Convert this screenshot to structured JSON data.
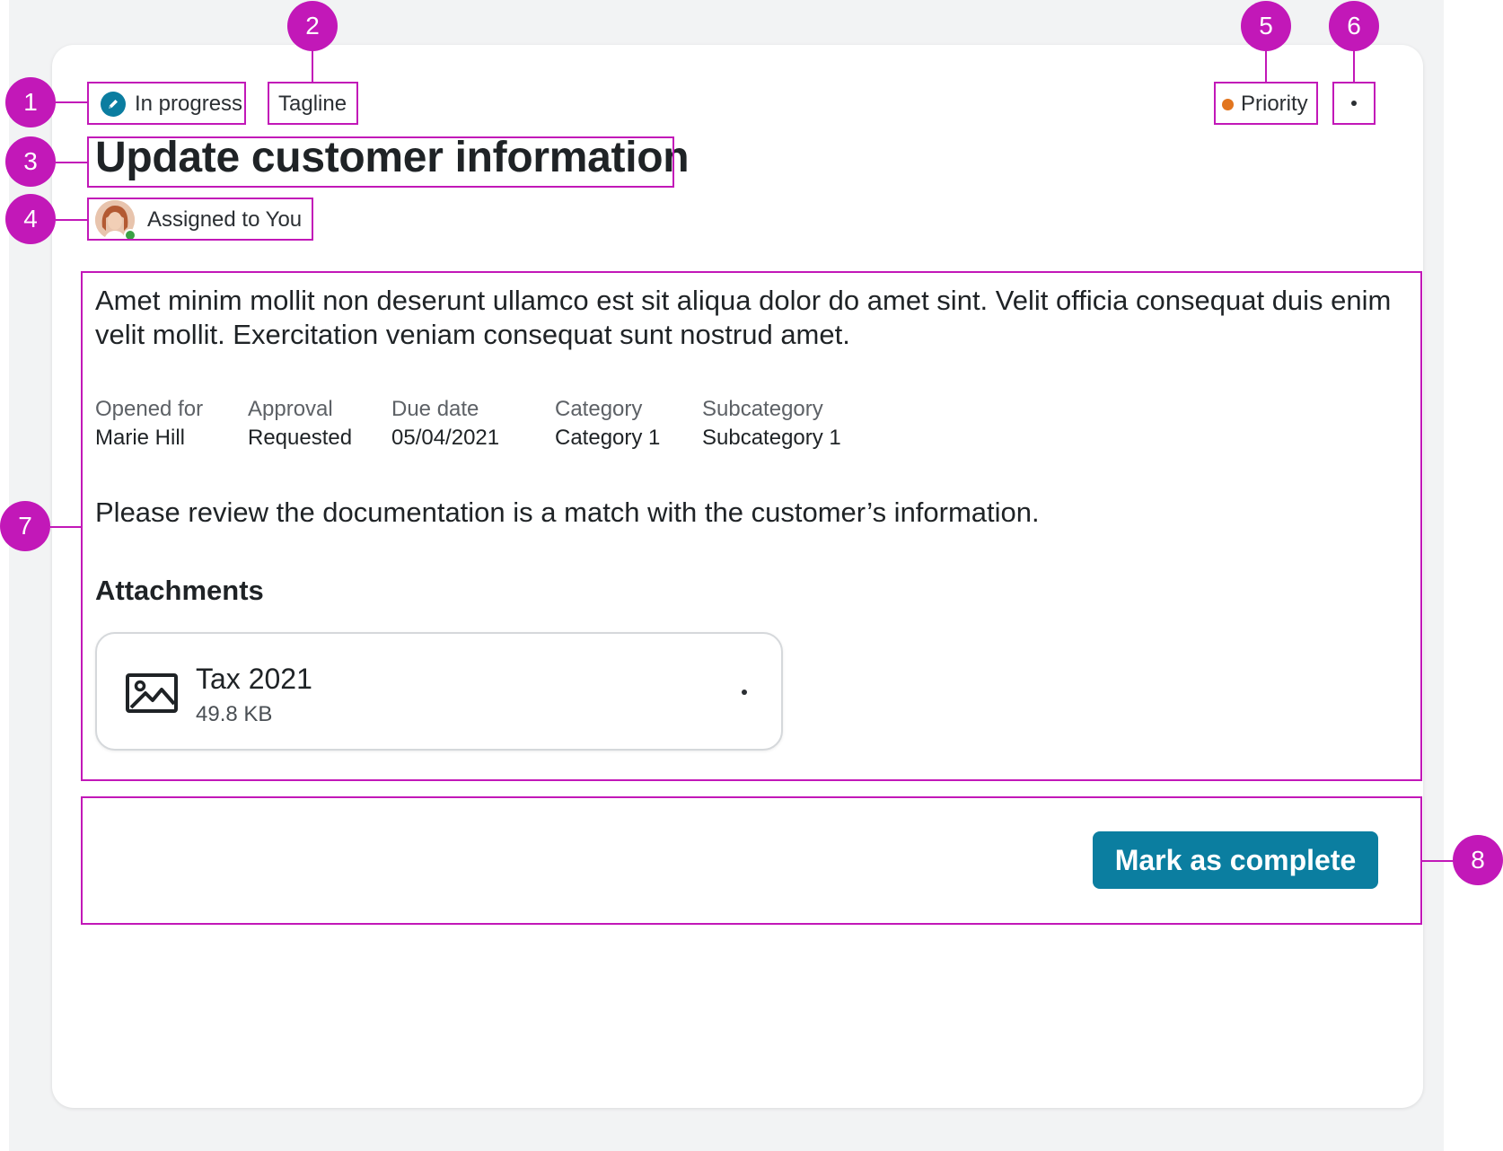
{
  "markers": [
    "1",
    "2",
    "3",
    "4",
    "5",
    "6",
    "7",
    "8"
  ],
  "header": {
    "status_label": "In progress",
    "status_icon": "pencil-icon",
    "tagline": "Tagline",
    "priority_label": "Priority",
    "priority_color": "#e2751e",
    "more_icon": "kebab-menu-icon"
  },
  "task": {
    "title": "Update customer information",
    "assignee_label": "Assigned to You"
  },
  "body": {
    "description": "Amet minim mollit non deserunt ullamco est sit aliqua dolor do amet sint. Velit officia consequat duis enim velit mollit. Exercitation veniam consequat sunt nostrud amet.",
    "fields": [
      {
        "label": "Opened for",
        "value": "Marie Hill"
      },
      {
        "label": "Approval",
        "value": "Requested"
      },
      {
        "label": "Due date",
        "value": "05/04/2021"
      },
      {
        "label": "Category",
        "value": "Category 1"
      },
      {
        "label": "Subcategory",
        "value": "Subcategory 1"
      }
    ],
    "note": "Please review the documentation is a match with the customer’s information.",
    "attachments_heading": "Attachments",
    "attachment": {
      "name": "Tax 2021",
      "size": "49.8 KB",
      "icon": "image-icon"
    }
  },
  "footer": {
    "primary_action": "Mark as complete",
    "accent_color": "#0b7ea0"
  },
  "annotation_color": "#c218b8"
}
